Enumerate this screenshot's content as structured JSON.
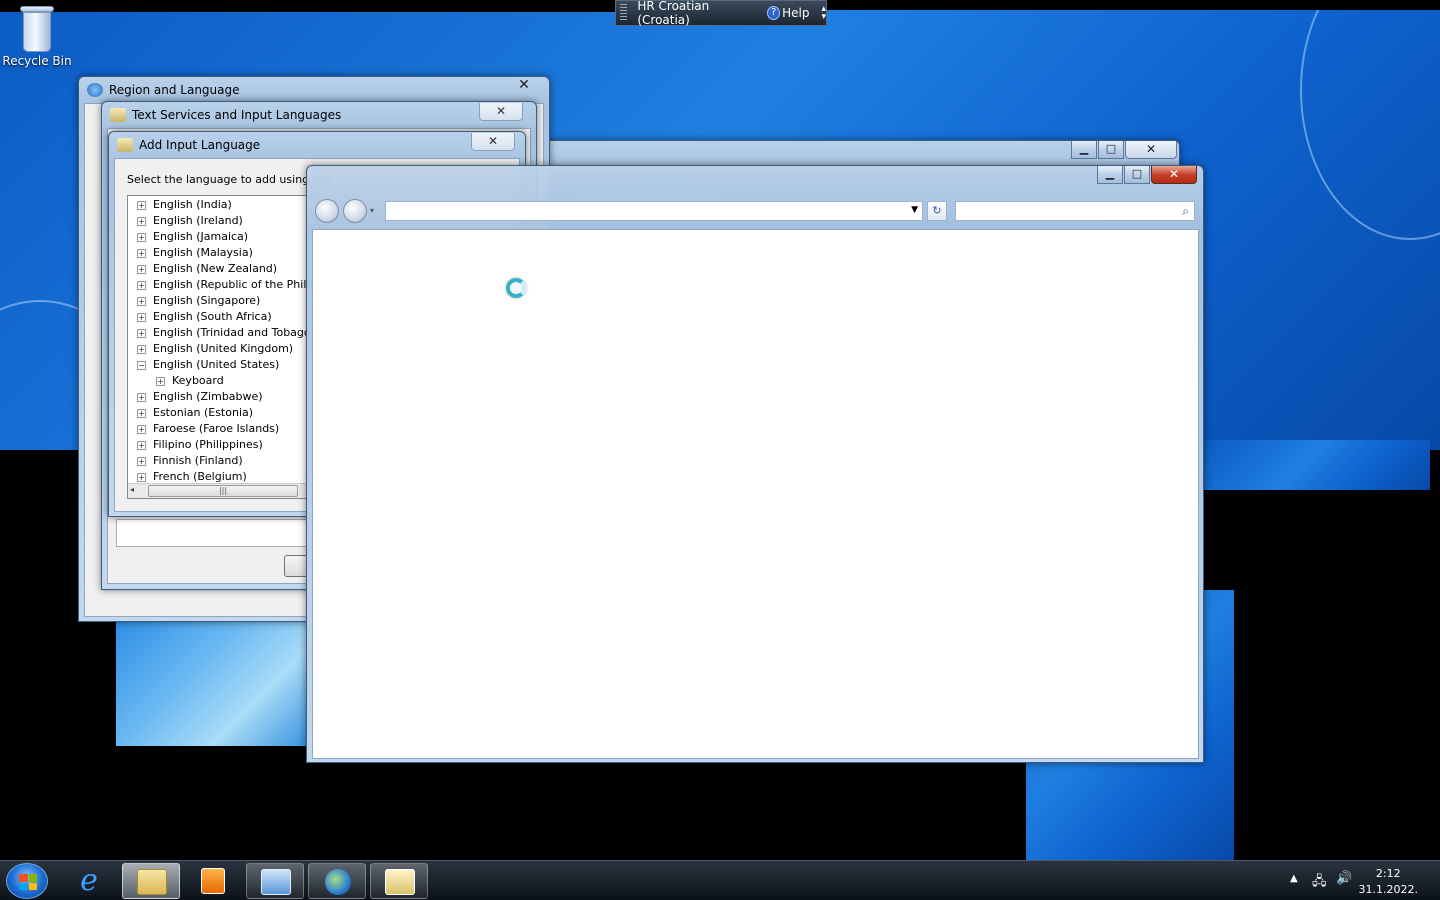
{
  "desktop": {
    "recycle_bin_label": "Recycle Bin"
  },
  "language_bar": {
    "input_language": "HR Croatian (Croatia)",
    "help_label": "Help"
  },
  "region_dialog": {
    "title": "Region and Language"
  },
  "text_services_dialog": {
    "title": "Text Services and Input Languages"
  },
  "add_input_dialog": {
    "title": "Add Input Language",
    "instruction": "Select the language to add using the",
    "languages": [
      {
        "label": "English (India)",
        "expander": "+"
      },
      {
        "label": "English (Ireland)",
        "expander": "+"
      },
      {
        "label": "English (Jamaica)",
        "expander": "+"
      },
      {
        "label": "English (Malaysia)",
        "expander": "+"
      },
      {
        "label": "English (New Zealand)",
        "expander": "+"
      },
      {
        "label": "English (Republic of the Philippin",
        "expander": "+"
      },
      {
        "label": "English (Singapore)",
        "expander": "+"
      },
      {
        "label": "English (South Africa)",
        "expander": "+"
      },
      {
        "label": "English (Trinidad and Tobago)",
        "expander": "+"
      },
      {
        "label": "English (United Kingdom)",
        "expander": "+"
      },
      {
        "label": "English (United States)",
        "expander": "−"
      },
      {
        "label": "Keyboard",
        "expander": "+",
        "child": true
      },
      {
        "label": "English (Zimbabwe)",
        "expander": "+"
      },
      {
        "label": "Estonian (Estonia)",
        "expander": "+"
      },
      {
        "label": "Faroese (Faroe Islands)",
        "expander": "+"
      },
      {
        "label": "Filipino (Philippines)",
        "expander": "+"
      },
      {
        "label": "Finnish (Finland)",
        "expander": "+"
      },
      {
        "label": "French (Belgium)",
        "expander": "+"
      }
    ]
  },
  "taskbar": {
    "time": "2:12",
    "date": "31.1.2022."
  },
  "colors": {
    "close_red": "#c8412a",
    "spinner": "#35b2c8",
    "desktop_blue": "#1f7fe0"
  }
}
